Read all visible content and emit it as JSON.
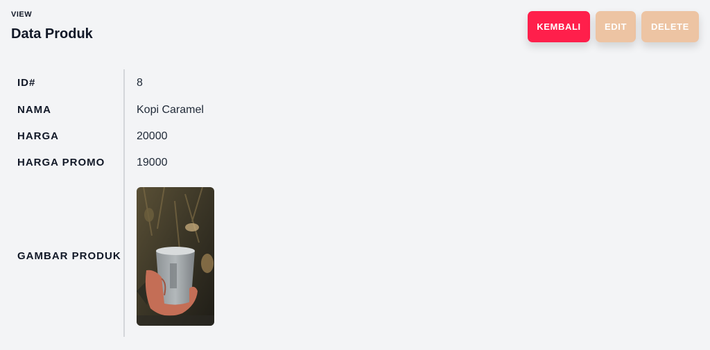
{
  "header": {
    "eyebrow": "VIEW",
    "title": "Data Produk"
  },
  "actions": {
    "back_label": "KEMBALI",
    "edit_label": "EDIT",
    "delete_label": "DELETE"
  },
  "colors": {
    "back": "#ff1f4b",
    "edit": "#edc4a3",
    "delete": "#edc4a3"
  },
  "product": {
    "fields": [
      {
        "label": "ID#",
        "value": "8"
      },
      {
        "label": "NAMA",
        "value": "Kopi Caramel"
      },
      {
        "label": "HARGA",
        "value": "20000"
      },
      {
        "label": "HARGA PROMO",
        "value": "19000"
      }
    ],
    "image_label": "GAMBAR PRODUK"
  }
}
